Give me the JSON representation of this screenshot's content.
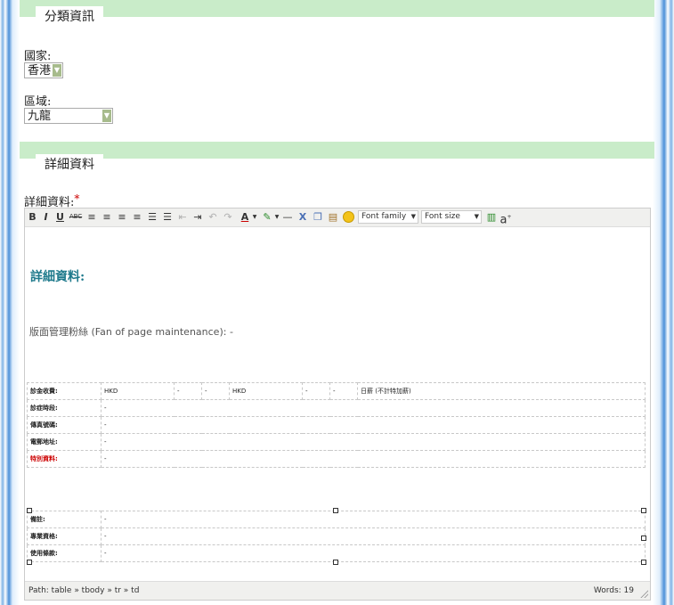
{
  "category_section": {
    "title": "分類資訊"
  },
  "country": {
    "label": "國家:",
    "value": "香港"
  },
  "region": {
    "label": "區域:",
    "value": "九龍"
  },
  "details_section": {
    "title": "詳細資料"
  },
  "details_field": {
    "label": "詳細資料:",
    "required_mark": "*"
  },
  "toolbar": {
    "bold": "B",
    "italic": "I",
    "underline": "U",
    "strike": "ABC",
    "font_color": "A",
    "hr": "—",
    "cut": "X",
    "font_family": "Font family",
    "font_size": "Font size",
    "case": "a"
  },
  "editor": {
    "heading": "詳細資料:",
    "paragraph": "版面管理粉絲 (Fan of page maintenance): -",
    "table1": {
      "row1": [
        "診金收費:",
        "HKD",
        "-",
        "-",
        "HKD",
        "-",
        "-",
        "日薪 (不計特加薪)"
      ],
      "rows": [
        {
          "k": "診症時段:",
          "v": "-"
        },
        {
          "k": "傳真號碼:",
          "v": "-"
        },
        {
          "k": "電郵地址:",
          "v": "-"
        },
        {
          "k": "特別資料:",
          "v": "-"
        }
      ]
    },
    "table2": {
      "rows": [
        {
          "k": "備註:",
          "v": "-"
        },
        {
          "k": "專業資格:",
          "v": "-"
        },
        {
          "k": "使用條款:",
          "v": "-"
        }
      ]
    },
    "path": "Path: table » tbody » tr » td",
    "words": "Words: 19"
  },
  "colors": {
    "band": "#c9ecc9",
    "heading": "#1f7a8c",
    "required": "#cc0000"
  }
}
